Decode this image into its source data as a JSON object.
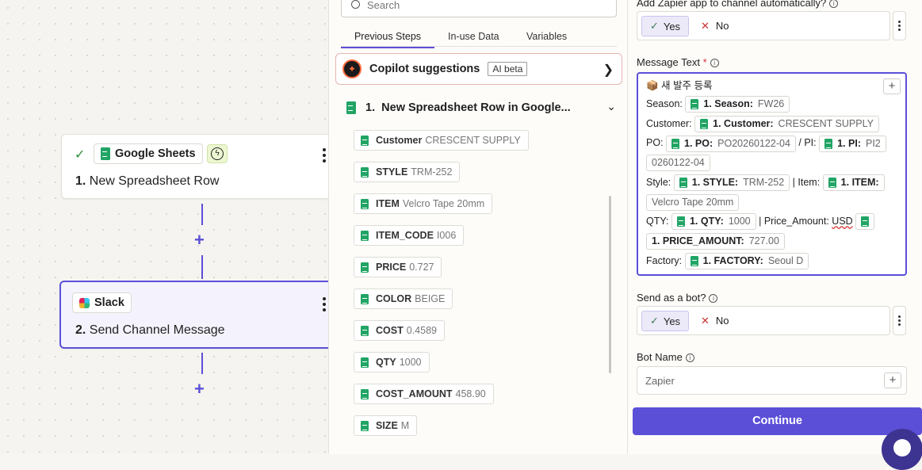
{
  "canvas": {
    "node1": {
      "app": "Google Sheets",
      "step_num": "1.",
      "title": "New Spreadsheet Row"
    },
    "node2": {
      "app": "Slack",
      "step_num": "2.",
      "title": "Send Channel Message"
    }
  },
  "panel": {
    "search_placeholder": "Search",
    "tabs": [
      "Previous Steps",
      "In-use Data",
      "Variables"
    ],
    "copilot": {
      "title": "Copilot suggestions",
      "badge": "AI beta"
    },
    "section": {
      "num": "1.",
      "title": "New Spreadsheet Row in Google..."
    },
    "fields": [
      {
        "key": "Customer",
        "value": "CRESCENT SUPPLY"
      },
      {
        "key": "STYLE",
        "value": "TRM-252"
      },
      {
        "key": "ITEM",
        "value": "Velcro Tape 20mm"
      },
      {
        "key": "ITEM_CODE",
        "value": "I006"
      },
      {
        "key": "PRICE",
        "value": "0.727"
      },
      {
        "key": "COLOR",
        "value": "BEIGE"
      },
      {
        "key": "COST",
        "value": "0.4589"
      },
      {
        "key": "QTY",
        "value": "1000"
      },
      {
        "key": "COST_AMOUNT",
        "value": "458.90"
      },
      {
        "key": "SIZE",
        "value": "M"
      }
    ]
  },
  "form": {
    "add_app_label": "Add Zapier app to channel automatically?",
    "yes": "Yes",
    "no": "No",
    "message_label": "Message Text",
    "required": "*",
    "message": {
      "heading": "📦 새 발주 등록",
      "season_label": "Season:",
      "season_pill_key": "1. Season:",
      "season_pill_val": "FW26",
      "customer_label": "Customer:",
      "customer_pill_key": "1. Customer:",
      "customer_pill_val": "CRESCENT SUPPLY",
      "po_label": "PO:",
      "po_pill_key": "1. PO:",
      "po_pill_val": "PO20260122-04",
      "pi_label": "/ PI:",
      "pi_pill_key": "1. PI:",
      "pi_pill_val_a": "PI2",
      "pi_pill_val_b": "0260122-04",
      "style_label": "Style:",
      "style_pill_key": "1. STYLE:",
      "style_pill_val": "TRM-252",
      "item_label": "| Item:",
      "item_pill_key": "1. ITEM:",
      "item_pill_val": "Velcro Tape 20mm",
      "qty_label": "QTY:",
      "qty_pill_key": "1. QTY:",
      "qty_pill_val": "1000",
      "price_label": "| Price_Amount:",
      "price_currency": "USD",
      "price_pill_key": "1. PRICE_AMOUNT:",
      "price_pill_val": "727.00",
      "factory_label": "Factory:",
      "factory_pill_key": "1. FACTORY:",
      "factory_pill_val": "Seoul D"
    },
    "bot_label": "Send as a bot?",
    "bot_name_label": "Bot Name",
    "bot_name_value": "Zapier",
    "continue": "Continue"
  }
}
